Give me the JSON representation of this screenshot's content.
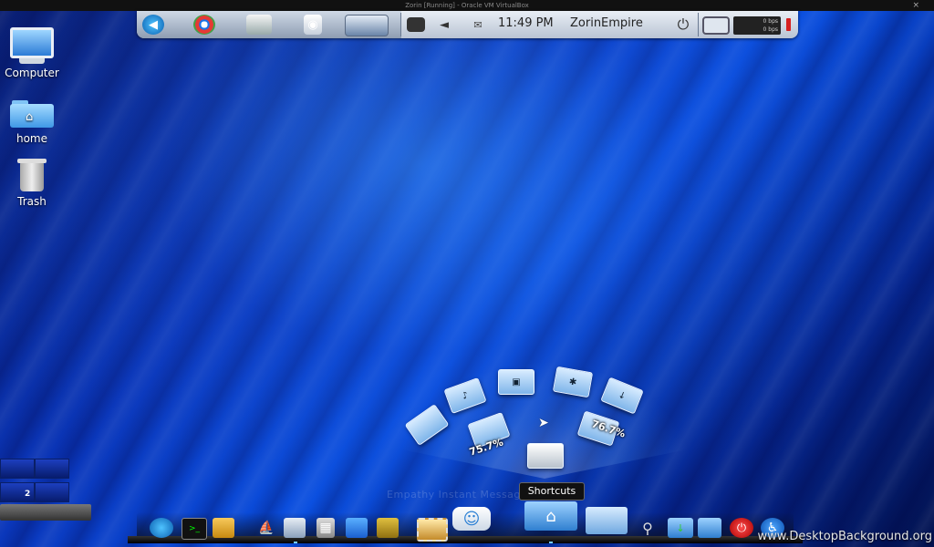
{
  "window": {
    "title": "Zorin [Running] - Oracle VM VirtualBox",
    "close_glyph": "×"
  },
  "top_panel": {
    "clock": "11:49 PM",
    "user": "ZorinEmpire",
    "net_up": "0 bps",
    "net_down": "0 bps",
    "battery_color": "#d62020"
  },
  "desktop_icons": [
    {
      "label": "Computer",
      "icon": "computer-icon"
    },
    {
      "label": "home",
      "icon": "home-folder-icon"
    },
    {
      "label": "Trash",
      "icon": "trash-icon"
    }
  ],
  "workspace": {
    "number": "2"
  },
  "fan_menu": {
    "badge_left": "75.7%",
    "badge_right": "76.7%",
    "ghost_text": "Empathy Instant Messaging"
  },
  "tooltip": {
    "label": "Shortcuts"
  },
  "watermark": {
    "text": "www.DesktopBackground.org"
  }
}
